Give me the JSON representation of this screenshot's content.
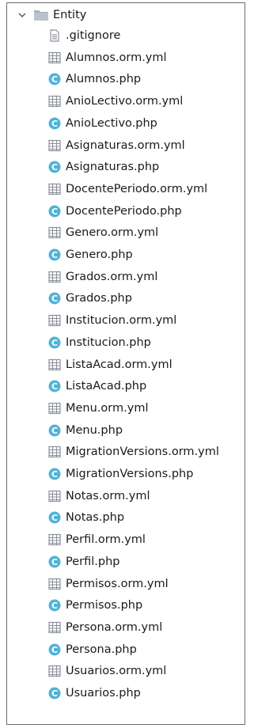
{
  "folder": {
    "label": "Entity",
    "expanded": true
  },
  "files": [
    {
      "name": ".gitignore",
      "type": "text"
    },
    {
      "name": "Alumnos.orm.yml",
      "type": "yml"
    },
    {
      "name": "Alumnos.php",
      "type": "php"
    },
    {
      "name": "AnioLectivo.orm.yml",
      "type": "yml"
    },
    {
      "name": "AnioLectivo.php",
      "type": "php"
    },
    {
      "name": "Asignaturas.orm.yml",
      "type": "yml"
    },
    {
      "name": "Asignaturas.php",
      "type": "php"
    },
    {
      "name": "DocentePeriodo.orm.yml",
      "type": "yml"
    },
    {
      "name": "DocentePeriodo.php",
      "type": "php"
    },
    {
      "name": "Genero.orm.yml",
      "type": "yml"
    },
    {
      "name": "Genero.php",
      "type": "php"
    },
    {
      "name": "Grados.orm.yml",
      "type": "yml"
    },
    {
      "name": "Grados.php",
      "type": "php"
    },
    {
      "name": "Institucion.orm.yml",
      "type": "yml"
    },
    {
      "name": "Institucion.php",
      "type": "php"
    },
    {
      "name": "ListaAcad.orm.yml",
      "type": "yml"
    },
    {
      "name": "ListaAcad.php",
      "type": "php"
    },
    {
      "name": "Menu.orm.yml",
      "type": "yml"
    },
    {
      "name": "Menu.php",
      "type": "php"
    },
    {
      "name": "MigrationVersions.orm.yml",
      "type": "yml"
    },
    {
      "name": "MigrationVersions.php",
      "type": "php"
    },
    {
      "name": "Notas.orm.yml",
      "type": "yml"
    },
    {
      "name": "Notas.php",
      "type": "php"
    },
    {
      "name": "Perfil.orm.yml",
      "type": "yml"
    },
    {
      "name": "Perfil.php",
      "type": "php"
    },
    {
      "name": "Permisos.orm.yml",
      "type": "yml"
    },
    {
      "name": "Permisos.php",
      "type": "php"
    },
    {
      "name": "Persona.orm.yml",
      "type": "yml"
    },
    {
      "name": "Persona.php",
      "type": "php"
    },
    {
      "name": "Usuarios.orm.yml",
      "type": "yml"
    },
    {
      "name": "Usuarios.php",
      "type": "php"
    }
  ],
  "icons": {
    "php": {
      "name": "php-class-icon",
      "glyph": "C",
      "color": "#4fb3d9"
    },
    "yml": {
      "name": "table-file-icon",
      "color": "#8a8f99"
    },
    "text": {
      "name": "text-file-icon",
      "color": "#8a8f99"
    },
    "folder": {
      "name": "folder-icon",
      "color": "#9aa5b4"
    }
  }
}
